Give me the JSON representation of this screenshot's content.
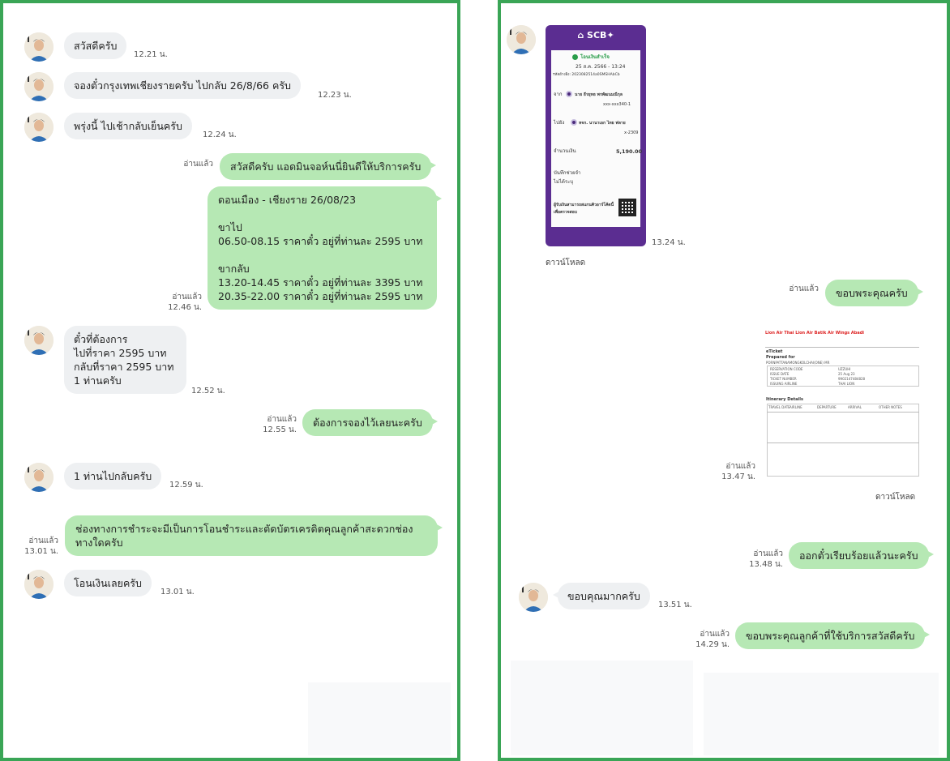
{
  "left": {
    "messages": [
      {
        "dir": "in",
        "text": "สวัสดีครับ",
        "time": "12.21 น."
      },
      {
        "dir": "in",
        "text": "จองตั๋วกรุงเทพเชียงรายครับ ไปกลับ 26/8/66 ครับ",
        "time": "12.23 น."
      },
      {
        "dir": "in",
        "text": "พรุ่งนี้ ไปเช้ากลับเย็นครับ",
        "time": "12.24 น."
      },
      {
        "dir": "out",
        "text": "สวัสดีครับ แอดมินจอห์นนี่ยินดีให้บริการครับ",
        "read": "อ่านแล้ว",
        "time": ""
      },
      {
        "dir": "out",
        "text": "ดอนเมือง - เชียงราย 26/08/23\n\nขาไป\n06.50-08.15  ราคาตั๋ว อยู่ที่ท่านละ 2595 บาท\n\nขากลับ\n13.20-14.45 ราคาตั๋ว อยู่ที่ท่านละ 3395 บาท\n20.35-22.00 ราคาตั๋ว อยู่ที่ท่านละ 2595 บาท",
        "read": "อ่านแล้ว",
        "time": "12.46 น."
      },
      {
        "dir": "in",
        "text": "ตั๋วที่ต้องการ\nไปที่ราคา 2595  บาท\nกลับที่ราคา 2595 บาท\n1 ท่านครับ",
        "time": "12.52 น."
      },
      {
        "dir": "out",
        "text": "ต้องการจองไว้เลยนะครับ",
        "read": "อ่านแล้ว",
        "time": "12.55 น."
      },
      {
        "dir": "in",
        "text": "1 ท่านไปกลับครับ",
        "time": "12.59 น."
      },
      {
        "dir": "out",
        "text": "ช่องทางการชำระจะมีเป็นการโอนชำระและตัดบัตรเครดิตคุณลูกค้าสะดวกช่องทางใดครับ",
        "read": "อ่านแล้ว",
        "time": "13.01 น."
      },
      {
        "dir": "in",
        "text": "โอนเงินเลยครับ",
        "time": "13.01 น."
      }
    ]
  },
  "right": {
    "slip": {
      "bank": "SCB",
      "status": "โอนเงินสำเร็จ",
      "datetime": "25 ส.ค. 2566 - 13:24",
      "ref": "รหัสอ้างอิง: 2023082514a0SMSHAbCb",
      "from_label": "จาก",
      "from_name": "นาย ธีรยุทธ พรพัฒนมณีกุล",
      "from_acc": "xxx-xxx340-1",
      "to_label": "ไปยัง",
      "to_name": "หจก. นานาเอก ไทย ฟลาย",
      "to_acc": "x-2309",
      "amount_label": "จำนวนเงิน",
      "amount": "5,190.00",
      "memo_label": "บันทึกช่วยจำ",
      "memo": "ไม่ได้ระบุ",
      "scan_note": "ผู้รับเงินสามารถสแกนคิวอาร์โค้ดนี้เพื่อตรวจสอบ",
      "time": "13.24 น.",
      "download": "ดาวน์โหลด"
    },
    "messages": [
      {
        "dir": "out",
        "text": "ขอบพระคุณครับ",
        "read": "อ่านแล้ว",
        "time": ""
      },
      {
        "dir": "out",
        "text": "ออกตั๋วเรียบร้อยแล้วนะครับ",
        "read": "อ่านแล้ว",
        "time": "13.48 น."
      },
      {
        "dir": "in",
        "text": "ขอบคุณมากครับ",
        "time": "13.51 น."
      },
      {
        "dir": "out",
        "text": "ขอบพระคุณลูกค้าที่ใช้บริการสวัสดีครับ",
        "read": "อ่านแล้ว",
        "time": "14.29 น."
      }
    ],
    "ticket": {
      "brand": "Lion Air  Thai Lion Air  Batik Air  Wings Abadi",
      "title": "eTicket",
      "prepared_for_label": "Prepared for",
      "passenger": "PORNPATTANAMONGKOLCHAI(ONE) MR",
      "rows": [
        {
          "k": "RESERVATION CODE",
          "v": "UZZUHI"
        },
        {
          "k": "ISSUE DATE",
          "v": "25 Aug 23"
        },
        {
          "k": "TICKET NUMBER",
          "v": "9902147484828"
        },
        {
          "k": "ISSUING AIRLINE",
          "v": "THAI LION"
        }
      ],
      "itinerary_title": "Itinerary Details",
      "columns": [
        "TRAVEL DATE",
        "AIRLINE",
        "DEPARTURE",
        "ARRIVAL",
        "OTHER NOTES"
      ],
      "read": "อ่านแล้ว",
      "time": "13.47 น.",
      "download": "ดาวน์โหลด"
    }
  },
  "colors": {
    "frame": "#3aa556",
    "outgoing_bubble": "#b6e8b4",
    "incoming_bubble": "#eef0f2",
    "slip_purple": "#5b2d91"
  }
}
